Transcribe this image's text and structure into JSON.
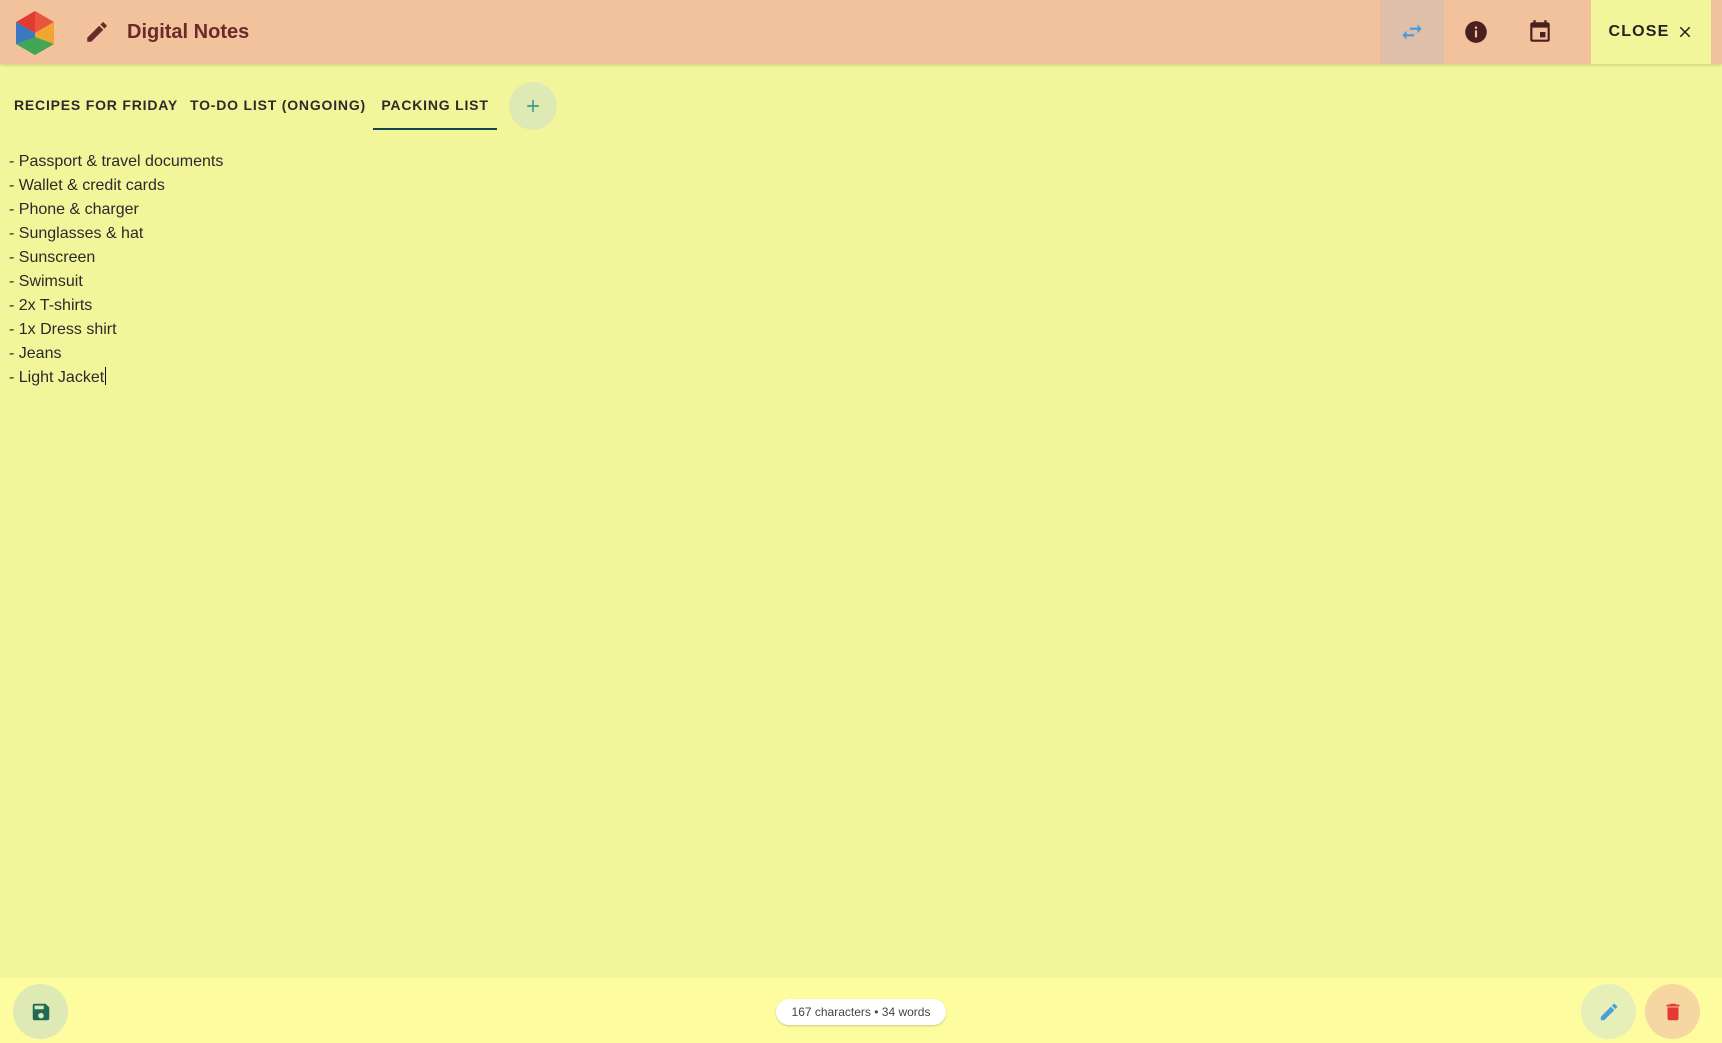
{
  "app": {
    "title": "Digital Notes"
  },
  "toolbar": {
    "close_label": "CLOSE",
    "icons": [
      "swap-icon",
      "info-icon",
      "calendar-icon",
      "close-icon"
    ]
  },
  "tabs": [
    {
      "label": "RECIPES FOR FRIDAY",
      "active": false
    },
    {
      "label": "TO-DO LIST (ONGOING)",
      "active": false
    },
    {
      "label": "PACKING LIST",
      "active": true
    }
  ],
  "note": {
    "lines": [
      "- Passport & travel documents",
      "- Wallet & credit cards",
      "- Phone & charger",
      "- Sunglasses & hat",
      "- Sunscreen",
      "- Swimsuit",
      "- 2x T-shirts",
      "- 1x Dress shirt",
      "- Jeans",
      "- Light Jacket"
    ]
  },
  "status": {
    "counter": "167 characters • 34 words"
  },
  "colors": {
    "topbar": "#f2c29c",
    "background": "#f3f59b",
    "title": "#6a2a2a",
    "swap_icon": "#4a9fd8",
    "delete_icon": "#e53935",
    "save_icon": "#1f6b57"
  }
}
